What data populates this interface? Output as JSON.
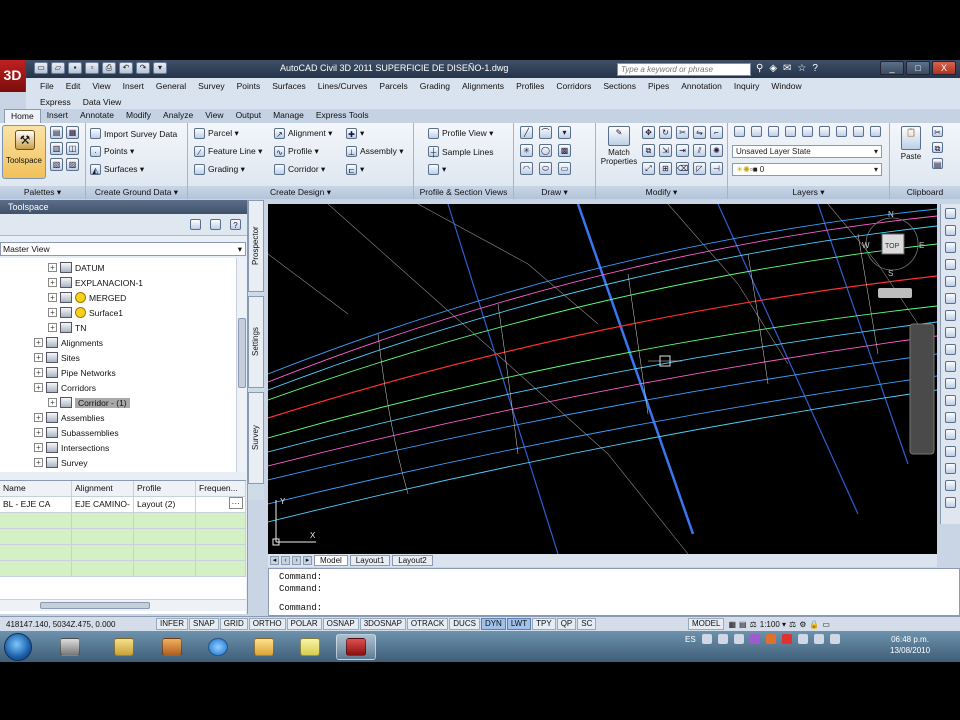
{
  "app": {
    "logo": "3D",
    "title": "AutoCAD Civil 3D 2011    SUPERFICIE DE DISEÑO-1.dwg",
    "search_placeholder": "Type a keyword or phrase",
    "window_controls": [
      "_",
      "□",
      "X"
    ]
  },
  "menubar": {
    "row1": [
      "File",
      "Edit",
      "View",
      "Insert",
      "General",
      "Survey",
      "Points",
      "Surfaces",
      "Lines/Curves",
      "Parcels",
      "Grading",
      "Alignments",
      "Profiles",
      "Corridors",
      "Sections",
      "Pipes",
      "Annotation",
      "Inquiry",
      "Window"
    ],
    "row2": [
      "Express",
      "Data View"
    ]
  },
  "ribbon_tabs": [
    "Home",
    "Insert",
    "Annotate",
    "Modify",
    "Analyze",
    "View",
    "Output",
    "Manage",
    "Express Tools"
  ],
  "ribbon": {
    "palettes": {
      "title": "Palettes ▾",
      "toolspace": "Toolspace"
    },
    "ground": {
      "title": "Create Ground Data ▾",
      "import_survey": "Import Survey Data",
      "points": "Points ▾",
      "surfaces": "Surfaces ▾"
    },
    "design": {
      "title": "Create Design ▾",
      "parcel": "Parcel ▾",
      "feature_line": "Feature Line ▾",
      "grading": "Grading ▾",
      "alignment": "Alignment ▾",
      "profile": "Profile ▾",
      "corridor": "Corridor ▾",
      "assembly": "Assembly ▾"
    },
    "profile_section": {
      "title": "Profile & Section Views",
      "profile_view": "Profile View ▾",
      "sample_lines": "Sample Lines"
    },
    "draw": {
      "title": "Draw ▾"
    },
    "modify": {
      "title": "Modify ▾",
      "match_properties": "Match Properties"
    },
    "layers": {
      "title": "Layers ▾",
      "layer_state": "Unsaved Layer State",
      "current_layer": "0"
    },
    "clipboard": {
      "title": "Clipboard",
      "paste": "Paste"
    }
  },
  "toolspace": {
    "title": "Toolspace",
    "view": "Master View",
    "tree": [
      {
        "label": "DATUM",
        "level": 3,
        "warn": false
      },
      {
        "label": "EXPLANACION-1",
        "level": 3,
        "warn": false
      },
      {
        "label": "MERGED",
        "level": 3,
        "warn": true
      },
      {
        "label": "Surface1",
        "level": 3,
        "warn": true
      },
      {
        "label": "TN",
        "level": 3,
        "warn": false
      },
      {
        "label": "Alignments",
        "level": 2,
        "warn": false
      },
      {
        "label": "Sites",
        "level": 2,
        "warn": false
      },
      {
        "label": "Pipe Networks",
        "level": 2,
        "warn": false
      },
      {
        "label": "Corridors",
        "level": 2,
        "warn": false
      },
      {
        "label": "Corridor - (1)",
        "level": 3,
        "warn": false,
        "selected": true
      },
      {
        "label": "Assemblies",
        "level": 2,
        "warn": false
      },
      {
        "label": "Subassemblies",
        "level": 2,
        "warn": false
      },
      {
        "label": "Intersections",
        "level": 2,
        "warn": false
      },
      {
        "label": "Survey",
        "level": 2,
        "warn": false
      }
    ],
    "side_tabs": [
      "Prospector",
      "Settings",
      "Survey"
    ],
    "grid_headers": [
      "Name",
      "Alignment",
      "Profile",
      "Frequen..."
    ],
    "grid_rows": [
      [
        "BL - EJE CA",
        "EJE CAMINO-",
        "Layout (2)",
        ""
      ]
    ]
  },
  "drawing": {
    "viewcube": {
      "n": "N",
      "s": "S",
      "e": "E",
      "w": "W",
      "top": "TOP"
    },
    "ucs_x": "X",
    "ucs_y": "Y"
  },
  "layout_tabs": [
    "Model",
    "Layout1",
    "Layout2"
  ],
  "command": {
    "lines": [
      "Command:",
      "Command:",
      "Command:"
    ]
  },
  "status": {
    "coords": "418147.140, 5034Z.475, 0.000",
    "toggles": [
      {
        "label": "INFER",
        "on": false
      },
      {
        "label": "SNAP",
        "on": false
      },
      {
        "label": "GRID",
        "on": false
      },
      {
        "label": "ORTHO",
        "on": false
      },
      {
        "label": "POLAR",
        "on": false
      },
      {
        "label": "OSNAP",
        "on": false
      },
      {
        "label": "3DOSNAP",
        "on": false
      },
      {
        "label": "OTRACK",
        "on": false
      },
      {
        "label": "DUCS",
        "on": false
      },
      {
        "label": "DYN",
        "on": true
      },
      {
        "label": "LWT",
        "on": true
      },
      {
        "label": "TPY",
        "on": false
      },
      {
        "label": "QP",
        "on": false
      },
      {
        "label": "SC",
        "on": false
      }
    ],
    "model": "MODEL",
    "scale": "1:100 ▾"
  },
  "taskbar": {
    "lang": "ES",
    "time": "06:48 p.m.",
    "date": "13/08/2010"
  },
  "colors": {
    "accent": "#4a6fa5",
    "viewport_bg": "#000000",
    "selection": "#a9a9a9"
  }
}
